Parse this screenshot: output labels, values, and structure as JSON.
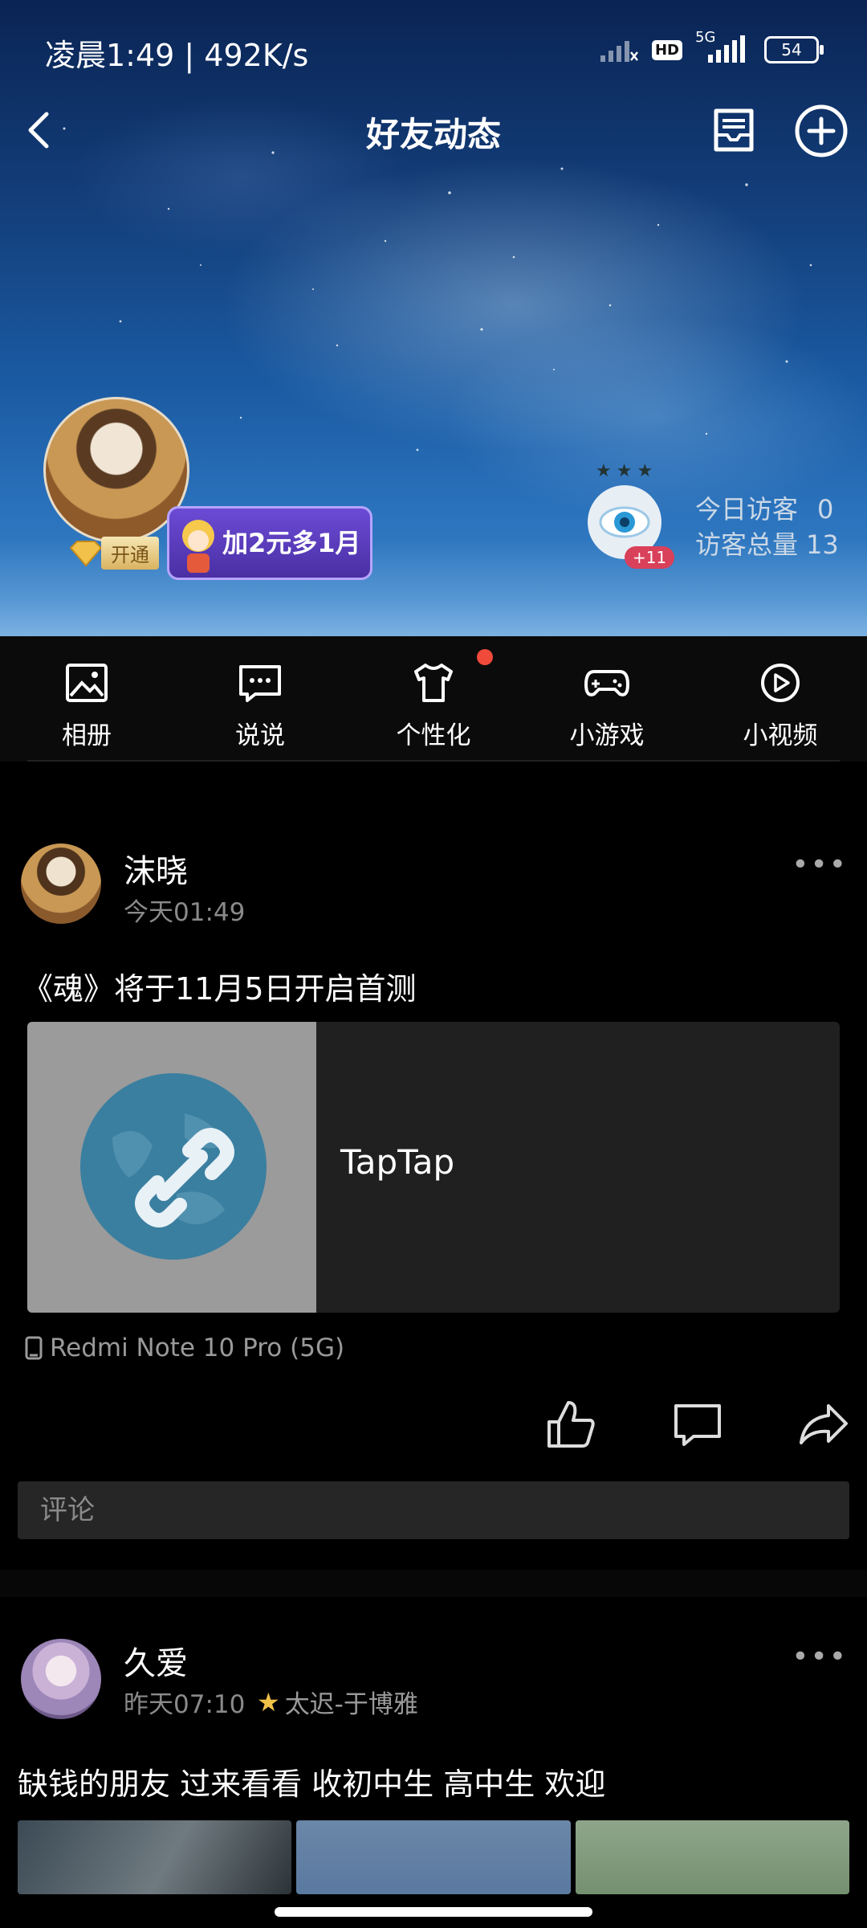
{
  "status": {
    "time": "凌晨1:49 | 492K/s",
    "net_badge": "HD",
    "net_type": "5G",
    "battery": "54"
  },
  "nav": {
    "title": "好友动态"
  },
  "profile": {
    "vip_open": "开通",
    "promo": "加2元多1月"
  },
  "visitors": {
    "badge": "+11",
    "today_label": "今日访客",
    "today_value": "0",
    "total_label": "访客总量",
    "total_value": "13"
  },
  "menu": {
    "items": [
      {
        "label": "相册",
        "icon": "photo-icon"
      },
      {
        "label": "说说",
        "icon": "chat-icon"
      },
      {
        "label": "个性化",
        "icon": "shirt-icon"
      },
      {
        "label": "小游戏",
        "icon": "gamepad-icon"
      },
      {
        "label": "小视频",
        "icon": "play-icon"
      }
    ]
  },
  "posts": [
    {
      "name": "沫晓",
      "time": "今天01:49",
      "text": "《魂》将于11月5日开启首测",
      "link_title": "TapTap",
      "device": "Redmi Note 10 Pro (5G)",
      "comment_placeholder": "评论"
    },
    {
      "name": "久爱",
      "time": "昨天07:10",
      "tag": "太迟-于博雅",
      "text": "缺钱的朋友 过来看看  收初中生 高中生 欢迎"
    }
  ],
  "colors": {
    "accent_red": "#f04a3a",
    "panel": "#202020",
    "comment_bg": "#262626"
  }
}
